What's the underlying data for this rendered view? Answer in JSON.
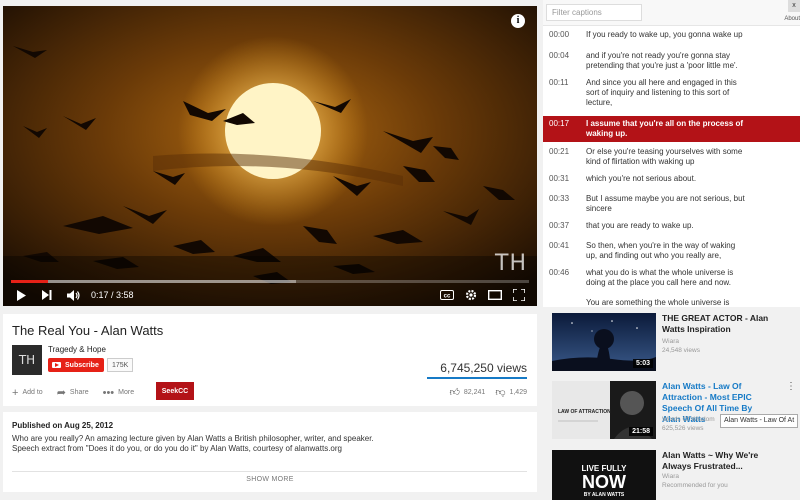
{
  "player": {
    "time": "0:17 / 3:58",
    "watermark": "TH",
    "progress_played": 0.071,
    "progress_loaded": 0.55
  },
  "video": {
    "title": "The Real You - Alan Watts",
    "channel": "Tragedy & Hope",
    "channel_avatar": "TH",
    "subscribe_label": "Subscribe",
    "subscriber_count": "175K",
    "views": "6,745,250 views",
    "actions": {
      "add_to": "Add to",
      "share": "Share",
      "more": "More"
    },
    "seekcc_label": "SeekCC",
    "likes": "82,241",
    "dislikes": "1,429"
  },
  "description": {
    "published": "Published on Aug 25, 2012",
    "line1": "Who are you really? An amazing lecture given by Alan Watts a British philosopher, writer, and speaker.",
    "line2": "Speech extract from \"Does it do you, or do you do it\" by Alan Watts, courtesy of alanwatts.org",
    "show_more": "SHOW MORE"
  },
  "captions": {
    "filter_placeholder": "Filter captions",
    "close": "x",
    "about": "About",
    "items": [
      {
        "time": "00:00",
        "text": "If you ready to wake up, you gonna wake up"
      },
      {
        "time": "00:04",
        "text": "and if you're not ready you're gonna stay pretending that you're just a 'poor little me'."
      },
      {
        "time": "00:11",
        "text": "And since you all here and engaged in this sort of inquiry and listening to this sort of lecture,"
      },
      {
        "time": "00:17",
        "text": "I assume that you're all on the process of waking up."
      },
      {
        "time": "00:21",
        "text": "Or else you're teasing yourselves with some kind of flirtation with waking up"
      },
      {
        "time": "00:31",
        "text": "which you're not serious about."
      },
      {
        "time": "00:33",
        "text": "But I assume maybe you are not serious, but sincere"
      },
      {
        "time": "00:37",
        "text": "that you are ready to wake up."
      },
      {
        "time": "00:41",
        "text": "So then, when you're in the way of waking up, and finding out who you really are,"
      },
      {
        "time": "00:46",
        "text": "what you do is what the whole universe is doing at the place you call here and now."
      },
      {
        "time": "",
        "text": "You are something the whole universe is"
      }
    ]
  },
  "recommendations": [
    {
      "title": "THE GREAT ACTOR - Alan Watts Inspiration",
      "channel": "Wiara",
      "meta": "24,548 views",
      "duration": "5:03"
    },
    {
      "title": "Alan Watts - Law Of Attraction - Most EPIC Speech Of All Time By Alan Watts",
      "channel": "Words Of Wisdom",
      "meta": "625,526 views",
      "duration": "21:58",
      "thumb_text": "LAW OF ATTRACTION"
    },
    {
      "title": "Alan Watts ~ Why We're Always Frustrated...",
      "channel": "Wiara",
      "meta": "Recommended for you",
      "thumb_text_1": "LIVE FULLY",
      "thumb_text_2": "NOW",
      "thumb_text_3": "BY ALAN WATTS"
    }
  ],
  "tooltip": "Alan Watts - Law Of At"
}
